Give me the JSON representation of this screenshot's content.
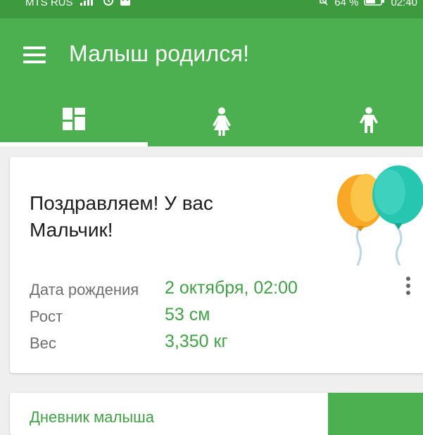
{
  "status_bar": {
    "carrier": "MTS RUS",
    "battery": "64 %",
    "time": "02:40",
    "icons": [
      "signal-icon",
      "alarm-icon",
      "wifi-icon",
      "mute-icon",
      "battery-icon"
    ]
  },
  "app_bar": {
    "title": "Малыш родился!",
    "menu_icon": "hamburger-icon",
    "tabs": [
      {
        "icon": "dashboard-icon",
        "selected": true
      },
      {
        "icon": "mother-icon",
        "selected": false
      },
      {
        "icon": "child-icon",
        "selected": false
      }
    ]
  },
  "birth_card": {
    "message": "Поздравляем! У вас Мальчик!",
    "rows": [
      {
        "label": "Дата рождения",
        "value": "2 октября, 02:00"
      },
      {
        "label": "Рост",
        "value": "53 см"
      },
      {
        "label": "Вес",
        "value": "3,350 кг"
      }
    ],
    "balloon_colors": [
      "#f9a826",
      "#26c6b1"
    ]
  },
  "diary_card": {
    "title": "Дневник малыша"
  },
  "colors": {
    "primary": "#4caf50",
    "status_bar": "#3d9a3f",
    "accent_text": "#43a047"
  }
}
